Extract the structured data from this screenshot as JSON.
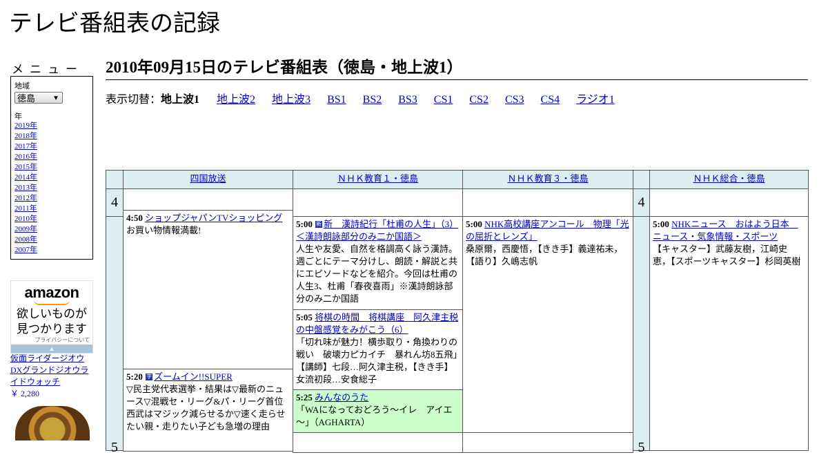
{
  "site": {
    "title": "テレビ番組表の記録"
  },
  "sidebar": {
    "menu_label": "メニュー",
    "region_label": "地域",
    "region_value": "徳島",
    "year_label": "年",
    "years": [
      "2019年",
      "2018年",
      "2017年",
      "2016年",
      "2015年",
      "2014年",
      "2013年",
      "2012年",
      "2011年",
      "2010年",
      "2009年",
      "2008年",
      "2007年"
    ]
  },
  "ad": {
    "logo": "amazon",
    "tagline_1": "欲しいものが",
    "tagline_2": "見つかります",
    "privacy": "プライバシーについて",
    "bar_glyph": "▲",
    "product_name": "仮面ライダージオウ DXグランドジオウライドウォッチ",
    "product_price": "￥ 2,280"
  },
  "main": {
    "heading": "2010年09月15日のテレビ番組表（徳島・地上波1）",
    "switch_label": "表示切替：",
    "switch_current": "地上波1",
    "switch_links": [
      "地上波2",
      "地上波3",
      "BS1",
      "BS2",
      "BS3",
      "CS1",
      "CS2",
      "CS3",
      "CS4",
      "ラジオ1"
    ]
  },
  "grid": {
    "channels": [
      "四国放送",
      "ＮＨＫ教育１・徳島",
      "ＮＨＫ教育３・徳島",
      "ＮＨＫ総合・徳島"
    ],
    "hours": [
      "4",
      "5"
    ],
    "programs": {
      "shikoku_1": {
        "time": "4:50",
        "title": "ショップジャパンTVショッピング",
        "desc": "お買い物情報満載!"
      },
      "shikoku_2": {
        "time": "5:20",
        "icon": "字",
        "title": "ズームイン!!SUPER",
        "desc": "▽民主党代表選挙・結果は▽最新のニュース▽混戦セ・リーグ&パ・リーグ首位　西武はマジック減らせるか▽速く走らせたい親・走りたい子ども急増の理由"
      },
      "edu1_1": {
        "time": "5:00",
        "icon": "新",
        "title": "新　漢詩紀行「杜甫の人生」（3）＜漢詩朗詠部分のみ二か国語＞",
        "desc": "人生や友愛、自然を格調高く詠う漢詩。週ごとにテーマ分けし、朗読・解説と共にエピソードなどを紹介。今回は杜甫の人生3、杜甫「春夜喜雨」※漢詩朗詠部分のみ二か国語"
      },
      "edu1_2": {
        "time": "5:05",
        "title": "将棋の時間　将棋講座　阿久津主税の中盤感覚をみがこう（6）",
        "desc": "「切れ味が魅力！横歩取り・角換わりの戦い　破壊力ピカイチ　暴れん坊8五飛」【講師】七段…阿久津主税，【きき手】女流初段…安食総子"
      },
      "edu1_3": {
        "time": "5:25",
        "title": "みんなのうた",
        "desc": "「WAになっておどろう～イレ　アイエ～」（AGHARTA）"
      },
      "edu3_1": {
        "time": "5:00",
        "title": "NHK高校講座アンコール　物理「光の屈折とレンズ」",
        "desc": "桑原爾，西慶悟，【きき手】義達祐未，【語り】久嶋志帆"
      },
      "sogo_1": {
        "time": "5:00",
        "title": "NHKニュース　おはよう日本　ニュース・気象情報・スポーツ",
        "desc": "【キャスター】武藤友樹，江崎史恵，【スポーツキャスター】杉岡英樹"
      }
    }
  }
}
